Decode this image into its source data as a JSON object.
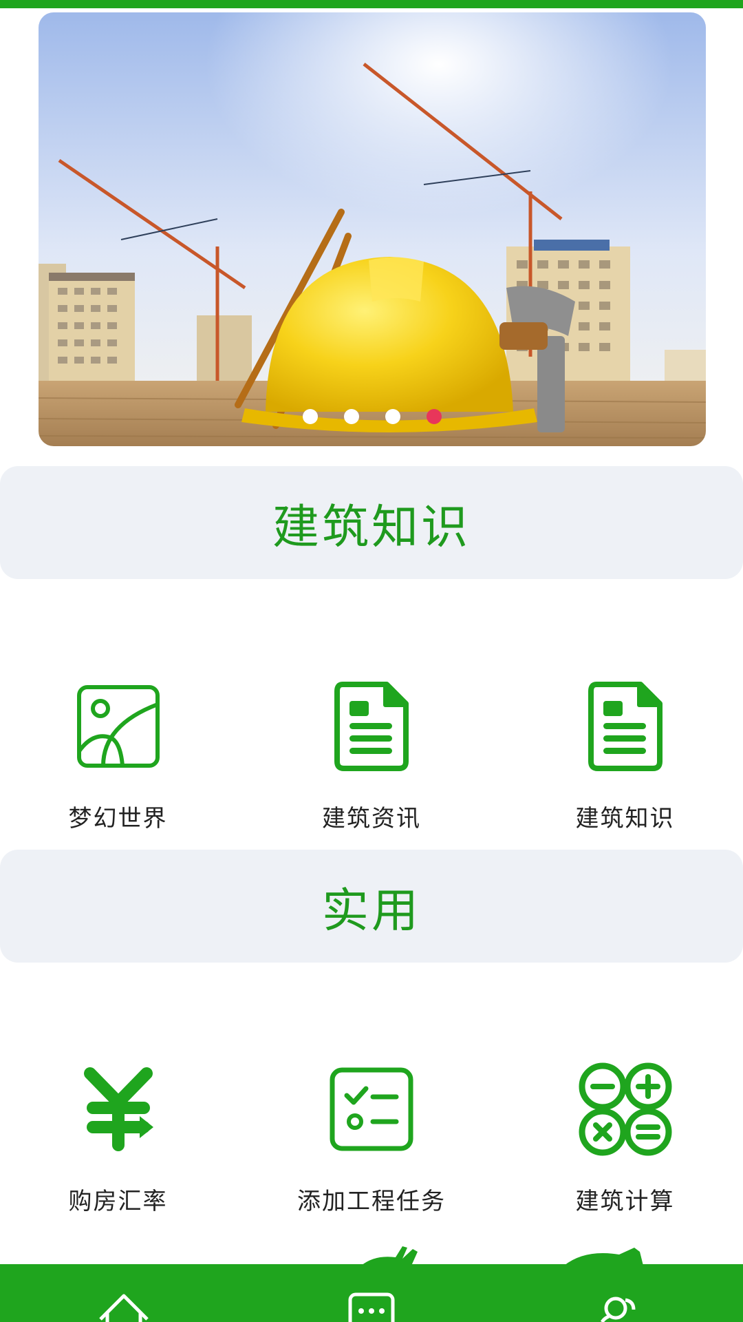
{
  "banner": {
    "image_name": "construction-helmet-cranes",
    "slide_count": 4,
    "active_slide": 4
  },
  "sections": [
    {
      "title": "建筑知识",
      "items": [
        {
          "label": "梦幻世界",
          "icon": "image-icon"
        },
        {
          "label": "建筑资讯",
          "icon": "document-icon"
        },
        {
          "label": "建筑知识",
          "icon": "document-icon"
        }
      ]
    },
    {
      "title": "实用",
      "items": [
        {
          "label": "购房汇率",
          "icon": "yuan-icon"
        },
        {
          "label": "添加工程任务",
          "icon": "task-checklist-icon"
        },
        {
          "label": "建筑计算",
          "icon": "calculator-icon"
        }
      ]
    }
  ],
  "bottom_nav": [
    {
      "name": "home",
      "icon": "home-icon"
    },
    {
      "name": "messages",
      "icon": "chat-icon"
    },
    {
      "name": "contacts",
      "icon": "users-icon"
    }
  ],
  "colors": {
    "brand_green": "#1fa51e",
    "label_green": "#1f9a1e",
    "section_bg": "#eef1f6",
    "active_dot": "#e8365a"
  }
}
